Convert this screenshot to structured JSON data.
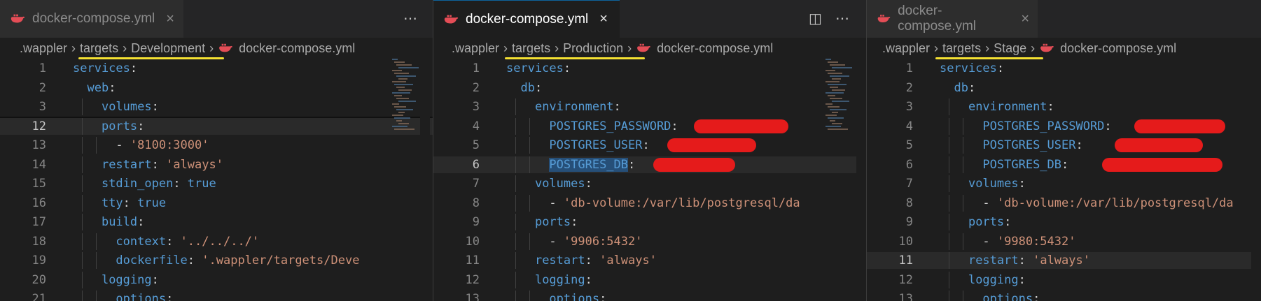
{
  "panes": [
    {
      "tab": {
        "title": "docker-compose.yml",
        "close": "×",
        "active": false
      },
      "actions": [
        "⋯"
      ],
      "breadcrumb": [
        ".wappler",
        "targets",
        "Development",
        "docker-compose.yml"
      ],
      "lines": [
        {
          "n": "1",
          "t": [
            [
              "k",
              "services"
            ],
            [
              "p",
              ":"
            ]
          ]
        },
        {
          "n": "2",
          "t": [
            [
              "p",
              "  "
            ],
            [
              "k",
              "web"
            ],
            [
              "p",
              ":"
            ]
          ]
        },
        {
          "n": "3",
          "t": [
            [
              "p",
              "    "
            ],
            [
              "k",
              "volumes"
            ],
            [
              "p",
              ":"
            ]
          ]
        },
        {
          "n": "12",
          "t": [
            [
              "p",
              "    "
            ],
            [
              "k",
              "ports"
            ],
            [
              "p",
              ":"
            ]
          ],
          "cur": true
        },
        {
          "n": "13",
          "t": [
            [
              "p",
              "      - "
            ],
            [
              "s",
              "'8100:3000'"
            ]
          ]
        },
        {
          "n": "14",
          "t": [
            [
              "p",
              "    "
            ],
            [
              "k",
              "restart"
            ],
            [
              "p",
              ": "
            ],
            [
              "s",
              "'always'"
            ]
          ]
        },
        {
          "n": "15",
          "t": [
            [
              "p",
              "    "
            ],
            [
              "k",
              "stdin_open"
            ],
            [
              "p",
              ": "
            ],
            [
              "b",
              "true"
            ]
          ]
        },
        {
          "n": "16",
          "t": [
            [
              "p",
              "    "
            ],
            [
              "k",
              "tty"
            ],
            [
              "p",
              ": "
            ],
            [
              "b",
              "true"
            ]
          ]
        },
        {
          "n": "17",
          "t": [
            [
              "p",
              "    "
            ],
            [
              "k",
              "build"
            ],
            [
              "p",
              ":"
            ]
          ]
        },
        {
          "n": "18",
          "t": [
            [
              "p",
              "      "
            ],
            [
              "k",
              "context"
            ],
            [
              "p",
              ": "
            ],
            [
              "s",
              "'../../../'"
            ]
          ]
        },
        {
          "n": "19",
          "t": [
            [
              "p",
              "      "
            ],
            [
              "k",
              "dockerfile"
            ],
            [
              "p",
              ": "
            ],
            [
              "s",
              "'.wappler/targets/Deve"
            ]
          ]
        },
        {
          "n": "20",
          "t": [
            [
              "p",
              "    "
            ],
            [
              "k",
              "logging"
            ],
            [
              "p",
              ":"
            ]
          ]
        },
        {
          "n": "21",
          "t": [
            [
              "p",
              "      "
            ],
            [
              "k",
              "options"
            ],
            [
              "p",
              ":"
            ]
          ]
        }
      ]
    },
    {
      "tab": {
        "title": "docker-compose.yml",
        "close": "×",
        "active": true
      },
      "actions": [
        "◫",
        "⋯"
      ],
      "breadcrumb": [
        ".wappler",
        "targets",
        "Production",
        "docker-compose.yml"
      ],
      "lines": [
        {
          "n": "1",
          "t": [
            [
              "k",
              "services"
            ],
            [
              "p",
              ":"
            ]
          ]
        },
        {
          "n": "2",
          "t": [
            [
              "p",
              "  "
            ],
            [
              "k",
              "db"
            ],
            [
              "p",
              ":"
            ]
          ]
        },
        {
          "n": "3",
          "t": [
            [
              "p",
              "    "
            ],
            [
              "k",
              "environment"
            ],
            [
              "p",
              ":"
            ]
          ]
        },
        {
          "n": "4",
          "t": [
            [
              "p",
              "      "
            ],
            [
              "k",
              "POSTGRES_PASSWORD"
            ],
            [
              "p",
              ":"
            ]
          ]
        },
        {
          "n": "5",
          "t": [
            [
              "p",
              "      "
            ],
            [
              "k",
              "POSTGRES_USER"
            ],
            [
              "p",
              ":"
            ]
          ]
        },
        {
          "n": "6",
          "t": [
            [
              "p",
              "      "
            ],
            [
              "k",
              "POSTGRES_DB"
            ],
            [
              "p",
              ":"
            ]
          ],
          "cur": true
        },
        {
          "n": "7",
          "t": [
            [
              "p",
              "    "
            ],
            [
              "k",
              "volumes"
            ],
            [
              "p",
              ":"
            ]
          ]
        },
        {
          "n": "8",
          "t": [
            [
              "p",
              "      - "
            ],
            [
              "s",
              "'db-volume:/var/lib/postgresql/da"
            ]
          ]
        },
        {
          "n": "9",
          "t": [
            [
              "p",
              "    "
            ],
            [
              "k",
              "ports"
            ],
            [
              "p",
              ":"
            ]
          ]
        },
        {
          "n": "10",
          "t": [
            [
              "p",
              "      - "
            ],
            [
              "s",
              "'9906:5432'"
            ]
          ]
        },
        {
          "n": "11",
          "t": [
            [
              "p",
              "    "
            ],
            [
              "k",
              "restart"
            ],
            [
              "p",
              ": "
            ],
            [
              "s",
              "'always'"
            ]
          ]
        },
        {
          "n": "12",
          "t": [
            [
              "p",
              "    "
            ],
            [
              "k",
              "logging"
            ],
            [
              "p",
              ":"
            ]
          ]
        },
        {
          "n": "13",
          "t": [
            [
              "p",
              "      "
            ],
            [
              "k",
              "options"
            ],
            [
              "p",
              ":"
            ]
          ]
        }
      ]
    },
    {
      "tab": {
        "title": "docker-compose.yml",
        "close": "×",
        "active": false
      },
      "actions": [],
      "breadcrumb": [
        ".wappler",
        "targets",
        "Stage",
        "docker-compose.yml"
      ],
      "lines": [
        {
          "n": "1",
          "t": [
            [
              "k",
              "services"
            ],
            [
              "p",
              ":"
            ]
          ]
        },
        {
          "n": "2",
          "t": [
            [
              "p",
              "  "
            ],
            [
              "k",
              "db"
            ],
            [
              "p",
              ":"
            ]
          ]
        },
        {
          "n": "3",
          "t": [
            [
              "p",
              "    "
            ],
            [
              "k",
              "environment"
            ],
            [
              "p",
              ":"
            ]
          ]
        },
        {
          "n": "4",
          "t": [
            [
              "p",
              "      "
            ],
            [
              "k",
              "POSTGRES_PASSWORD"
            ],
            [
              "p",
              ":"
            ]
          ]
        },
        {
          "n": "5",
          "t": [
            [
              "p",
              "      "
            ],
            [
              "k",
              "POSTGRES_USER"
            ],
            [
              "p",
              ":"
            ]
          ]
        },
        {
          "n": "6",
          "t": [
            [
              "p",
              "      "
            ],
            [
              "k",
              "POSTGRES_DB"
            ],
            [
              "p",
              ":"
            ]
          ]
        },
        {
          "n": "7",
          "t": [
            [
              "p",
              "    "
            ],
            [
              "k",
              "volumes"
            ],
            [
              "p",
              ":"
            ]
          ]
        },
        {
          "n": "8",
          "t": [
            [
              "p",
              "      - "
            ],
            [
              "s",
              "'db-volume:/var/lib/postgresql/da"
            ]
          ]
        },
        {
          "n": "9",
          "t": [
            [
              "p",
              "    "
            ],
            [
              "k",
              "ports"
            ],
            [
              "p",
              ":"
            ]
          ]
        },
        {
          "n": "10",
          "t": [
            [
              "p",
              "      - "
            ],
            [
              "s",
              "'9980:5432'"
            ]
          ]
        },
        {
          "n": "11",
          "t": [
            [
              "p",
              "    "
            ],
            [
              "k",
              "restart"
            ],
            [
              "p",
              ": "
            ],
            [
              "s",
              "'always'"
            ]
          ],
          "cur": true
        },
        {
          "n": "12",
          "t": [
            [
              "p",
              "    "
            ],
            [
              "k",
              "logging"
            ],
            [
              "p",
              ":"
            ]
          ]
        },
        {
          "n": "13",
          "t": [
            [
              "p",
              "      "
            ],
            [
              "k",
              "options"
            ],
            [
              "p",
              ":"
            ]
          ]
        }
      ]
    }
  ],
  "colors": {
    "accent_underline": "#f5e132",
    "redaction": "#e51b1b",
    "key": "#569cd6",
    "string": "#ce9178"
  },
  "icons": {
    "file": "docker-whale-icon",
    "separator": "chevron-right-icon"
  }
}
